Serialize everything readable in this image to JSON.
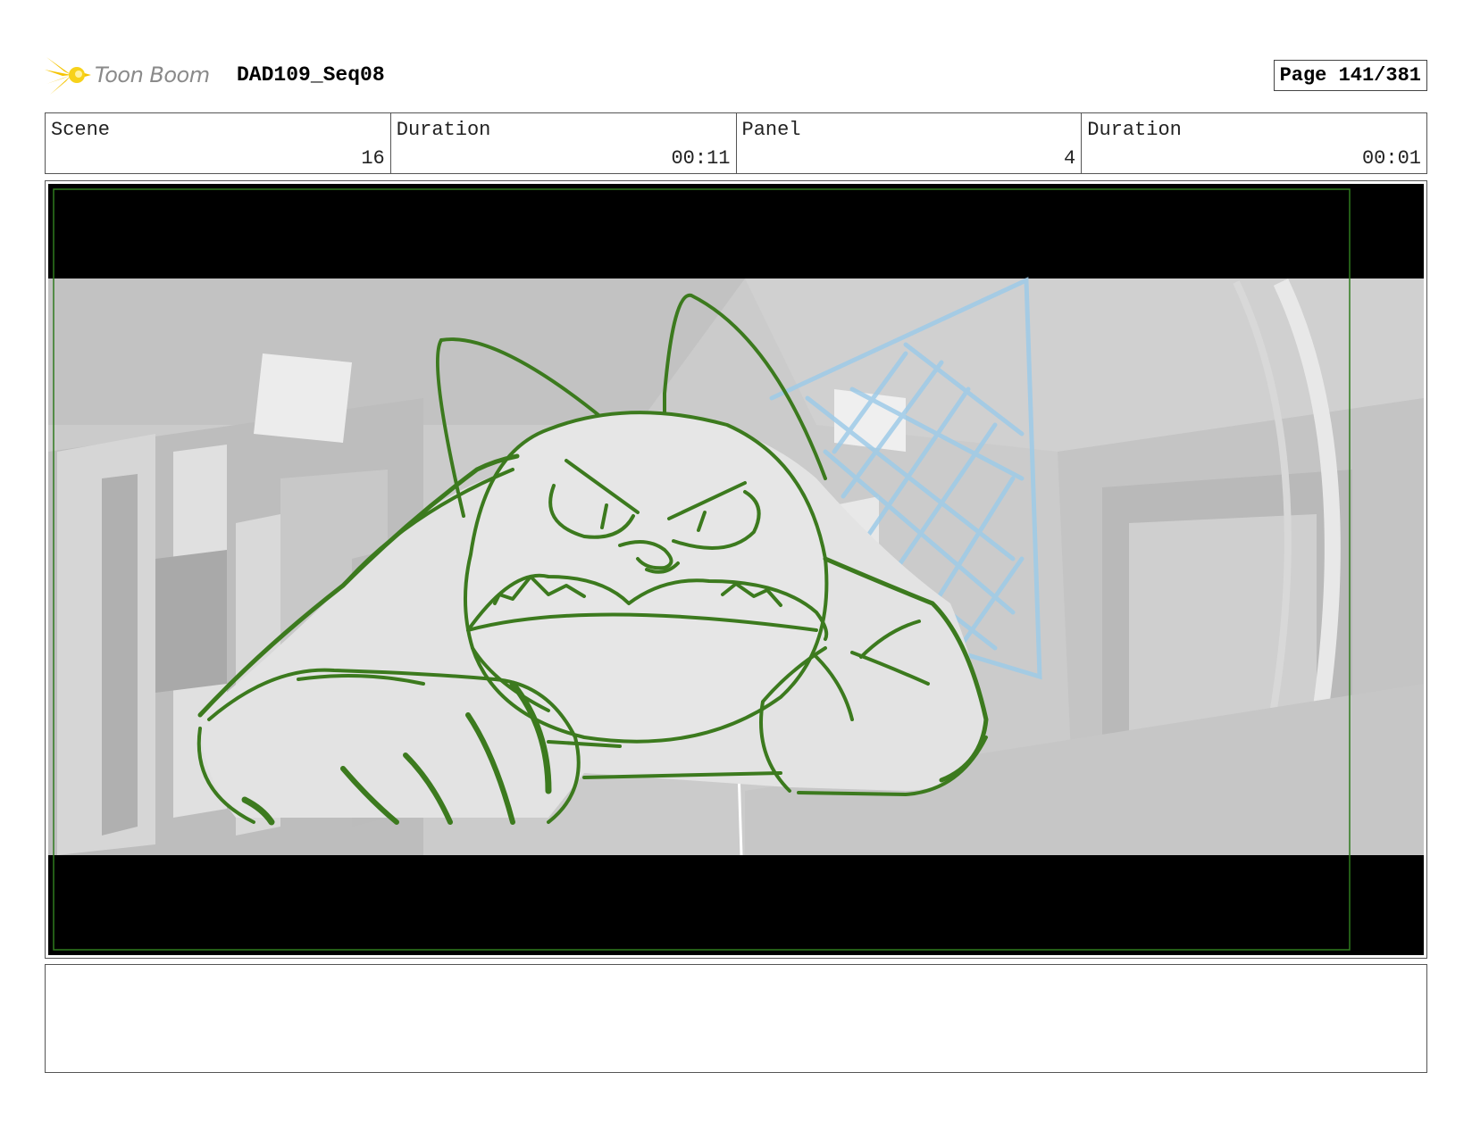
{
  "header": {
    "logo_text": "Toon Boom",
    "sequence": "DAD109_Seq08",
    "page": "Page 141/381"
  },
  "info": {
    "scene_label": "Scene",
    "scene_value": "16",
    "scene_duration_label": "Duration",
    "scene_duration_value": "00:11",
    "panel_label": "Panel",
    "panel_value": "4",
    "panel_duration_label": "Duration",
    "panel_duration_value": "00:01"
  },
  "colors": {
    "sketch_line": "#3c7a1e",
    "safe_frame": "#2f7a1e",
    "net_line": "#9ecbe8",
    "background_gray": "#c9c9c9",
    "letterbox": "#000000"
  },
  "notes": {
    "text": ""
  }
}
